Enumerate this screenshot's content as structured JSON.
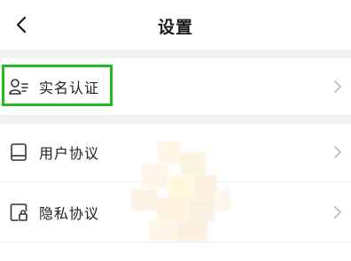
{
  "header": {
    "title": "设置",
    "back_icon": "chevron-left-icon"
  },
  "rows": [
    {
      "label": "实名认证",
      "icon": "id-verify-icon",
      "highlighted": true
    },
    {
      "label": "用户协议",
      "icon": "book-icon",
      "highlighted": false
    },
    {
      "label": "隐私协议",
      "icon": "lock-document-icon",
      "highlighted": false
    }
  ],
  "colors": {
    "highlight": "#22bb22",
    "separator": "#f2f2f2",
    "text": "#222222",
    "chevron": "#b8b8b8"
  }
}
